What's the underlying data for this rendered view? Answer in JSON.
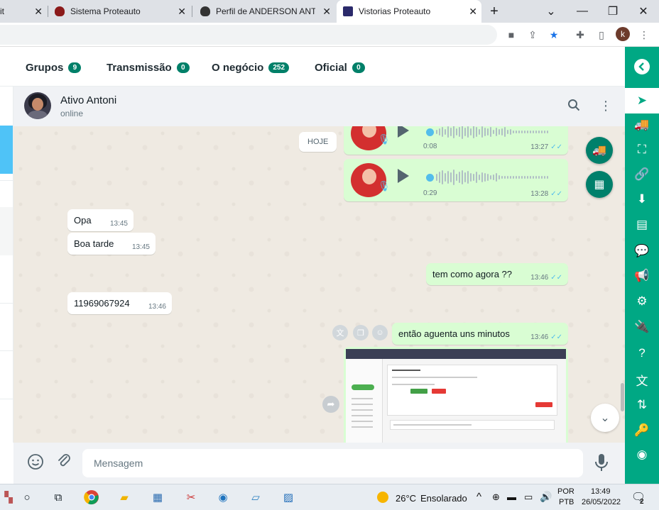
{
  "browser": {
    "tabs": [
      {
        "title": "it"
      },
      {
        "title": "Sistema Proteauto"
      },
      {
        "title": "Perfil de ANDERSON ANTONIO"
      },
      {
        "title": "Vistorias Proteauto"
      }
    ],
    "new_tab_symbol": "+",
    "profile_initial": "k"
  },
  "app_tabs": [
    {
      "label": "Grupos",
      "count": "9"
    },
    {
      "label": "Transmissão",
      "count": "0"
    },
    {
      "label": "O negócio",
      "count": "252"
    },
    {
      "label": "Oficial",
      "count": "0"
    }
  ],
  "chat": {
    "contact_name": "Ativo Antoni",
    "contact_status": "online",
    "date_chip": "HOJE",
    "voice_messages": [
      {
        "duration": "0:08",
        "time": "13:27"
      },
      {
        "duration": "0:29",
        "time": "13:28"
      }
    ],
    "messages": [
      {
        "text": "Opa",
        "time": "13:45"
      },
      {
        "text": "Boa tarde",
        "time": "13:45"
      },
      {
        "text": "tem como agora ??",
        "time": "13:46"
      },
      {
        "text": "11969067924",
        "time": "13:46"
      },
      {
        "text": "então aguenta uns minutos",
        "time": "13:46"
      }
    ],
    "ticks": "✓✓"
  },
  "composer": {
    "placeholder": "Mensagem"
  },
  "taskbar": {
    "weather_temp": "26°C",
    "weather_desc": "Ensolarado",
    "lang_top": "POR",
    "lang_bottom": "PTB",
    "clock_time": "13:49",
    "clock_date": "26/05/2022",
    "notif_count": "2"
  },
  "colors": {
    "brand_green": "#00a884",
    "dark_green": "#008069",
    "outgoing_bubble": "#d9fdd3",
    "chat_bg": "#efeae2"
  }
}
